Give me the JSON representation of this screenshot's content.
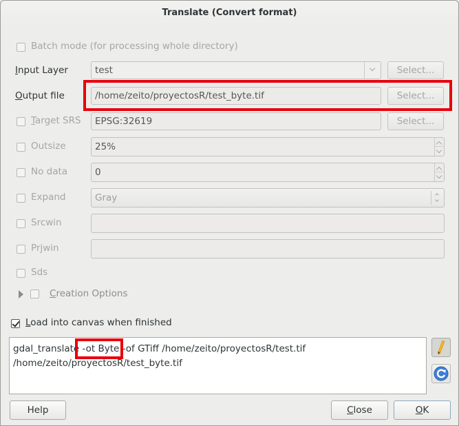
{
  "window": {
    "title": "Translate (Convert format)"
  },
  "batch_mode": {
    "label": "Batch mode (for processing whole directory)",
    "checked": false
  },
  "input_layer": {
    "label_mnemonic": "I",
    "label_rest": "nput Layer",
    "value": "test",
    "select_label": "Select..."
  },
  "output_file": {
    "label_mnemonic": "O",
    "label_rest": "utput file",
    "value": "/home/zeito/proyectosR/test_byte.tif",
    "select_label": "Select..."
  },
  "target_srs": {
    "label_mnemonic": "T",
    "label_rest": "arget SRS",
    "value": "EPSG:32619",
    "select_label": "Select...",
    "checked": false
  },
  "outsize": {
    "label": "Outsize",
    "value": "25%",
    "checked": false
  },
  "no_data": {
    "label": "No data",
    "value": "0",
    "checked": false
  },
  "expand": {
    "label": "Expand",
    "value": "Gray",
    "checked": false
  },
  "srcwin": {
    "label": "Srcwin",
    "value": "",
    "checked": false
  },
  "prjwin": {
    "label": "Prjwin",
    "value": "",
    "checked": false
  },
  "sds": {
    "label": "Sds",
    "checked": false
  },
  "creation_options": {
    "label_mnemonic": "C",
    "label_rest": "reation Options",
    "checked": false,
    "expanded": false
  },
  "load_into_canvas": {
    "label_mnemonic": "L",
    "label_rest": "oad into canvas when finished",
    "checked": true
  },
  "command": {
    "part1": "gdal_translate",
    "highlight": " -ot Byte ",
    "part2": "-of GTiff /home/zeito/proyectosR/test.tif",
    "line2": "/home/zeito/proyectosR/test_byte.tif"
  },
  "side_icons": {
    "edit": "pencil-icon",
    "reset": "refresh-icon"
  },
  "buttons": {
    "help": "Help",
    "close_mnemonic": "C",
    "close_rest": "lose",
    "ok_mnemonic": "O",
    "ok_rest": "K"
  },
  "annotation_color": "#e8000b"
}
